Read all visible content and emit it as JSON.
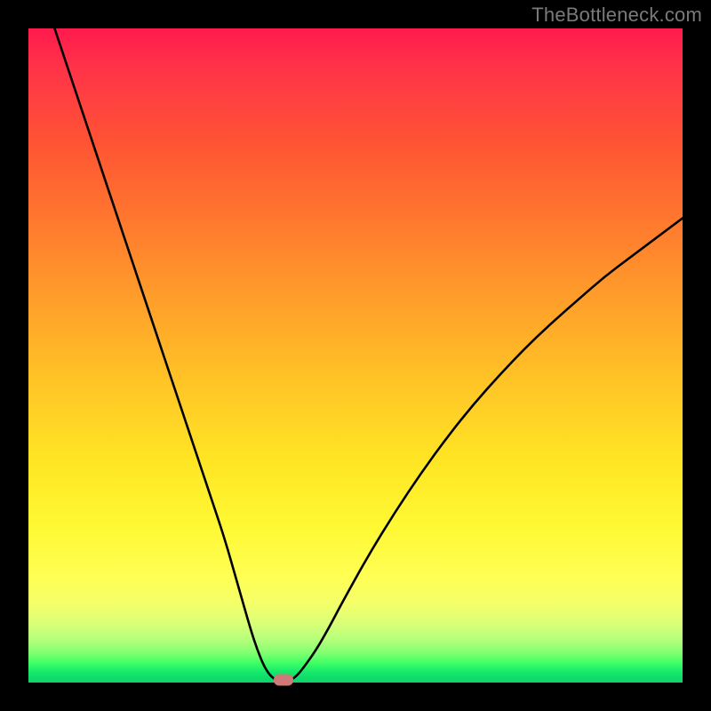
{
  "watermark": "TheBottleneck.com",
  "chart_data": {
    "type": "line",
    "title": "",
    "xlabel": "",
    "ylabel": "",
    "xlim": [
      0,
      100
    ],
    "ylim": [
      0,
      100
    ],
    "grid": false,
    "series": [
      {
        "name": "bottleneck-curve",
        "x": [
          4,
          6,
          8,
          10,
          12,
          14,
          16,
          18,
          20,
          22,
          24,
          26,
          28,
          30,
          32,
          34,
          35,
          36,
          37,
          38,
          39,
          40,
          41,
          42,
          44,
          46,
          48,
          52,
          56,
          60,
          64,
          68,
          72,
          76,
          80,
          84,
          88,
          92,
          96,
          100
        ],
        "y": [
          100,
          94,
          88,
          82,
          76,
          70,
          64,
          58,
          52,
          46,
          40,
          34,
          28,
          22,
          15,
          8,
          5,
          2.5,
          1,
          0.3,
          0,
          0.3,
          1,
          2.2,
          5,
          8.5,
          12.3,
          19.5,
          26,
          32,
          37.5,
          42.5,
          47,
          51.2,
          55,
          58.5,
          62,
          65,
          68,
          71
        ]
      }
    ],
    "minimum_marker": {
      "x": 39,
      "y": 0
    },
    "background_gradient": {
      "stops": [
        {
          "pos": 0.0,
          "color": "#ff1a4d"
        },
        {
          "pos": 0.18,
          "color": "#ff5533"
        },
        {
          "pos": 0.42,
          "color": "#ffa02a"
        },
        {
          "pos": 0.66,
          "color": "#ffe524"
        },
        {
          "pos": 0.84,
          "color": "#ffff55"
        },
        {
          "pos": 0.95,
          "color": "#80ff70"
        },
        {
          "pos": 1.0,
          "color": "#0fd16c"
        }
      ]
    }
  }
}
